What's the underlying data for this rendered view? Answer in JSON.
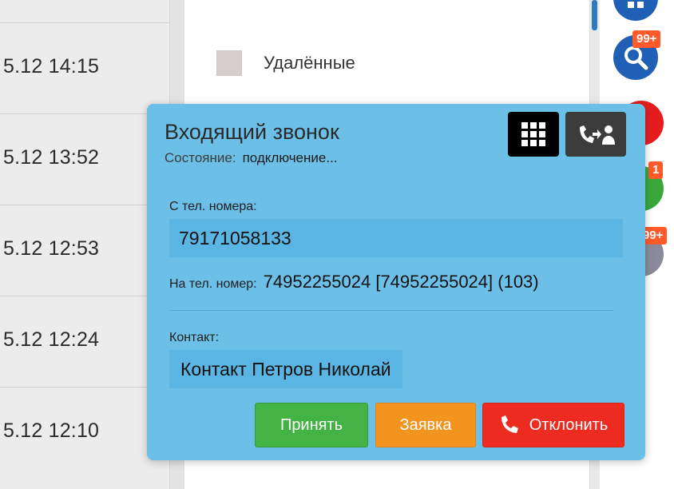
{
  "left_table": {
    "rows": [
      {
        "time": "5.12 14:15"
      },
      {
        "time": "5.12 13:52"
      },
      {
        "time": "5.12 12:53"
      },
      {
        "time": "5.12 12:24"
      },
      {
        "time": "5.12 12:10"
      }
    ]
  },
  "list": {
    "deleted_label": "Удалённые"
  },
  "side_badges": {
    "badge_top": "99+",
    "badge_mid": "1",
    "badge_low": "99+"
  },
  "dialog": {
    "title": "Входящий звонок",
    "status_label": "Состояние:",
    "status_value": "подключение...",
    "from_label": "С тел. номера:",
    "from_number": "79171058133",
    "to_label": "На тел. номер:",
    "to_value": "74952255024 [74952255024] (103)",
    "contact_label": "Контакт:",
    "contact_value": "Контакт Петров Николай",
    "buttons": {
      "accept": "Принять",
      "request": "Заявка",
      "decline": "Отклонить"
    }
  },
  "colors": {
    "dialog_bg": "#6cc0e8",
    "accept": "#43b346",
    "request": "#f2941e",
    "decline": "#ee2b20"
  }
}
